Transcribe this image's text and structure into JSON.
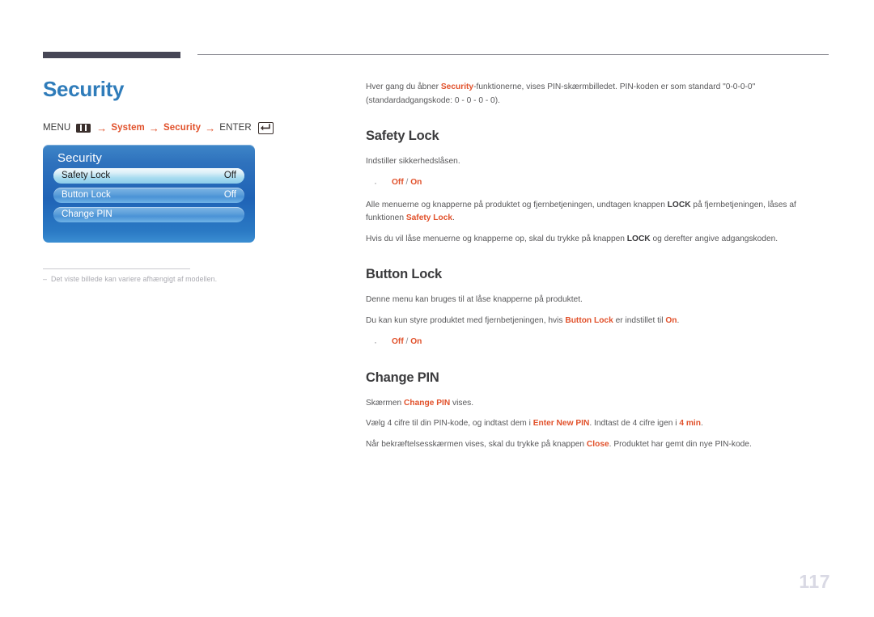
{
  "page": {
    "title": "Security",
    "number": "117"
  },
  "breadcrumb": {
    "menu_label": "MENU",
    "menu_icon": "menu-grid-icon",
    "arrow": "→",
    "step1": "System",
    "step2": "Security",
    "enter_label": "ENTER",
    "enter_icon": "enter-return-icon"
  },
  "osd": {
    "title": "Security",
    "rows": [
      {
        "label": "Safety Lock",
        "value": "Off",
        "selected": true
      },
      {
        "label": "Button Lock",
        "value": "Off",
        "selected": false
      },
      {
        "label": "Change PIN",
        "value": "",
        "selected": false
      }
    ]
  },
  "footnote": {
    "dash": "–",
    "text": "Det viste billede kan variere afhængigt af modellen."
  },
  "intro": {
    "p1_a": "Hver gang du åbner ",
    "p1_red": "Security",
    "p1_b": "-funktionerne, vises PIN-skærmbilledet. PIN-koden er som standard \"0-0-0-0\" (standardadgangskode: 0 - 0 - 0 - 0)."
  },
  "sections": [
    {
      "heading": "Safety Lock",
      "p1": "Indstiller sikkerhedslåsen.",
      "bullet_off": "Off",
      "bullet_sep": " / ",
      "bullet_on": "On",
      "p2_a": "Alle menuerne og knapperne på produktet og fjernbetjeningen, undtagen knappen ",
      "p2_bold": "LOCK",
      "p2_b": " på fjernbetjeningen, låses af funktionen ",
      "p2_red": "Safety Lock",
      "p2_c": ".",
      "p3_a": "Hvis du vil låse menuerne og knapperne op, skal du trykke på knappen ",
      "p3_bold": "LOCK",
      "p3_b": " og derefter angive adgangskoden."
    },
    {
      "heading": "Button Lock",
      "p1": "Denne menu kan bruges til at låse knapperne på produktet.",
      "p2_a": "Du kan kun styre produktet med fjernbetjeningen, hvis ",
      "p2_red1": "Button Lock",
      "p2_b": " er indstillet til ",
      "p2_red2": "On",
      "p2_c": ".",
      "bullet_off": "Off",
      "bullet_sep": " / ",
      "bullet_on": "On"
    },
    {
      "heading": "Change PIN",
      "p1_a": "Skærmen ",
      "p1_red": "Change PIN",
      "p1_b": " vises.",
      "p2_a": "Vælg 4 cifre til din PIN-kode, og indtast dem i ",
      "p2_red1": "Enter New PIN",
      "p2_b": ". Indtast de 4 cifre igen i ",
      "p2_red2": "4 min",
      "p2_c": ".",
      "p3_a": "Når bekræftelsesskærmen vises, skal du trykke på knappen ",
      "p3_red": "Close",
      "p3_b": ". Produktet har gemt din nye PIN-kode."
    }
  ],
  "colors": {
    "title_blue": "#2f7cba",
    "accent_red": "#e1512b",
    "body_gray": "#58585a",
    "osd_blue": "#1f63b6",
    "page_num": "#d9d9e4"
  }
}
